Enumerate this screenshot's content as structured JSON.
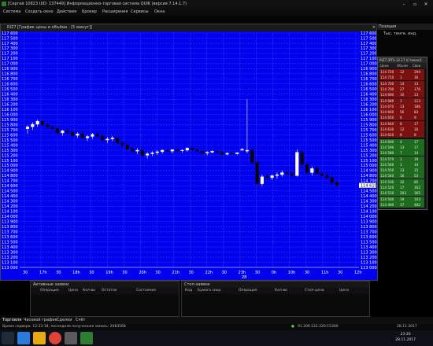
{
  "window": {
    "title": "[Сергей 10823 UID: 137449] Информационно-торговая система QUIK (версия 7.14.1.7)",
    "min": "–",
    "max": "▫",
    "close": "✕"
  },
  "menu": [
    "Система",
    "Создать окно",
    "Действия",
    "Брокер",
    "Расширения",
    "Сервисы",
    "Окна"
  ],
  "chart_window": {
    "title": "RIZ7 [График цены и объёма - [5 минут]]",
    "close": "✕"
  },
  "position": {
    "title": "Позиция",
    "subtitle": "Тыс. тенге. инд."
  },
  "dom": {
    "title": "RIZ7 [RTS-12.17 (Стакан)]",
    "cols": [
      "Цена",
      "Объем",
      "Свои"
    ],
    "sell": [
      [
        "114 720",
        "12",
        "294"
      ],
      [
        "114 710",
        "1",
        "16"
      ],
      [
        "114 700",
        "14",
        "13"
      ],
      [
        "114 700",
        "27",
        "176"
      ],
      [
        "114 690",
        "10",
        "13"
      ],
      [
        "114 680",
        "1",
        "113"
      ],
      [
        "114 670",
        "13",
        "186"
      ],
      [
        "114 660",
        "56",
        "83"
      ],
      [
        "114 650",
        "6",
        "9"
      ],
      [
        "114 640",
        "8",
        "17"
      ],
      [
        "114 630",
        "12",
        "16"
      ],
      [
        "114 620",
        "8",
        "8"
      ]
    ],
    "buy": [
      [
        "114 600",
        "4",
        "17"
      ],
      [
        "114 590",
        "13",
        "17"
      ],
      [
        "114 580",
        "7",
        "14"
      ],
      [
        "114 570",
        "1",
        "19"
      ],
      [
        "114 560",
        "1",
        "14"
      ],
      [
        "114 550",
        "13",
        "15"
      ],
      [
        "114 540",
        "16",
        "53"
      ],
      [
        "114 530",
        "32",
        "85"
      ],
      [
        "114 520",
        "17",
        "162"
      ],
      [
        "114 510",
        "203",
        "365"
      ],
      [
        "114 500",
        "19",
        "103"
      ],
      [
        "114 490",
        "17",
        "482"
      ]
    ]
  },
  "orders": {
    "active_title": "Активные заявки",
    "active_cols": [
      "Операция",
      "Цена",
      "Кол-во",
      "Остаток",
      "Состояние"
    ],
    "stop_title": "Стоп-заявки",
    "stop_cols": [
      "Код",
      "Бумага сокр.",
      "Операция",
      "Кол-во",
      "Стоп-цена",
      "Цена"
    ]
  },
  "tabs": [
    "Торговля",
    "Часовой график",
    "Сделки",
    "Счёт"
  ],
  "status": {
    "left": "Время сервера: 12:23:18; последняя полученная запись: 2083568",
    "ip": "91.209.122.220:15300",
    "date": "28.11.2017"
  },
  "taskbar": {
    "time": "23:26",
    "date": "28.11.2017"
  },
  "colors": {
    "chart_bg": "#0000ee",
    "grid": "#5a6bff",
    "bear": "#000000",
    "bull": "#ffffff",
    "sell": "#7a1010",
    "buy": "#1e6a1e"
  },
  "chart_data": {
    "type": "candlestick",
    "ylim": [
      113000,
      117600
    ],
    "y_ticks": [
      113000,
      113100,
      113200,
      113300,
      113400,
      113500,
      113600,
      113700,
      113800,
      113900,
      114000,
      114100,
      114200,
      114300,
      114400,
      114500,
      114600,
      114700,
      114800,
      114900,
      115000,
      115100,
      115200,
      115300,
      115400,
      115500,
      115600,
      115700,
      115800,
      115900,
      116000,
      116100,
      116200,
      116300,
      116400,
      116500,
      116600,
      116700,
      116800,
      116900,
      117000,
      117100,
      117200,
      117300,
      117400,
      117500,
      117600
    ],
    "x_labels": [
      "30",
      "17h",
      "30",
      "18h",
      "30",
      "19h",
      "30",
      "20h",
      "30",
      "21h",
      "30",
      "22h",
      "30",
      "23h",
      "30",
      "0h",
      "10h",
      "30",
      "11h",
      "30",
      "12h"
    ],
    "x_date_label": "28",
    "last_price": 114610,
    "candles": [
      [
        115720,
        115790,
        115620,
        115760
      ],
      [
        115760,
        115850,
        115700,
        115810
      ],
      [
        115810,
        115900,
        115760,
        115870
      ],
      [
        115870,
        115880,
        115780,
        115800
      ],
      [
        115800,
        115840,
        115720,
        115750
      ],
      [
        115750,
        115800,
        115680,
        115720
      ],
      [
        115720,
        115760,
        115600,
        115640
      ],
      [
        115640,
        115700,
        115580,
        115680
      ],
      [
        115680,
        115720,
        115620,
        115650
      ],
      [
        115650,
        115680,
        115560,
        115590
      ],
      [
        115590,
        115650,
        115540,
        115620
      ],
      [
        115620,
        115660,
        115520,
        115540
      ],
      [
        115540,
        115600,
        115480,
        115570
      ],
      [
        115570,
        115640,
        115520,
        115610
      ],
      [
        115610,
        115660,
        115560,
        115580
      ],
      [
        115580,
        115620,
        115480,
        115500
      ],
      [
        115500,
        115560,
        115440,
        115520
      ],
      [
        115520,
        115580,
        115480,
        115540
      ],
      [
        115540,
        115560,
        115420,
        115440
      ],
      [
        115440,
        115480,
        115360,
        115400
      ],
      [
        115400,
        115440,
        115300,
        115320
      ],
      [
        115320,
        115360,
        115240,
        115280
      ],
      [
        115280,
        115340,
        115220,
        115300
      ],
      [
        115300,
        115320,
        115180,
        115200
      ],
      [
        115200,
        115260,
        115140,
        115230
      ],
      [
        115230,
        115280,
        115180,
        115250
      ],
      [
        115250,
        115300,
        115210,
        115270
      ],
      [
        115270,
        115320,
        115230,
        115300
      ],
      [
        115300,
        115340,
        115260,
        115280
      ],
      [
        115280,
        115320,
        115240,
        115310
      ],
      [
        115310,
        115340,
        115270,
        115290
      ],
      [
        115290,
        115320,
        115250,
        115300
      ],
      [
        115300,
        115360,
        115270,
        115340
      ],
      [
        115340,
        115360,
        115290,
        115310
      ],
      [
        115310,
        115330,
        115260,
        115280
      ],
      [
        115280,
        115300,
        115220,
        115240
      ],
      [
        115240,
        115280,
        115200,
        115260
      ],
      [
        115260,
        115300,
        115240,
        115280
      ],
      [
        115280,
        115300,
        115240,
        115260
      ],
      [
        115260,
        115280,
        115200,
        115220
      ],
      [
        115220,
        115260,
        115200,
        115240
      ],
      [
        115240,
        115260,
        115210,
        115230
      ],
      [
        115230,
        115260,
        115210,
        115250
      ],
      [
        115300,
        115340,
        115280,
        115320
      ],
      [
        115280,
        116300,
        115240,
        115300
      ],
      [
        115300,
        115340,
        115000,
        115060
      ],
      [
        115060,
        115120,
        114560,
        114640
      ],
      [
        114640,
        114820,
        114600,
        114780
      ],
      [
        114780,
        114840,
        114700,
        114760
      ],
      [
        114760,
        114820,
        114720,
        114800
      ],
      [
        114800,
        114860,
        114740,
        114820
      ],
      [
        114820,
        114900,
        114780,
        114860
      ],
      [
        114860,
        114900,
        114800,
        114840
      ],
      [
        114840,
        114880,
        114780,
        114800
      ],
      [
        114800,
        115320,
        114780,
        115260
      ],
      [
        115260,
        115300,
        114960,
        115020
      ],
      [
        115020,
        115080,
        114820,
        114860
      ],
      [
        114860,
        114980,
        114800,
        114940
      ],
      [
        114940,
        114980,
        114820,
        114840
      ],
      [
        114840,
        114880,
        114760,
        114800
      ],
      [
        114800,
        114860,
        114720,
        114760
      ],
      [
        114760,
        114800,
        114620,
        114660
      ],
      [
        114660,
        114700,
        114560,
        114610
      ]
    ]
  }
}
